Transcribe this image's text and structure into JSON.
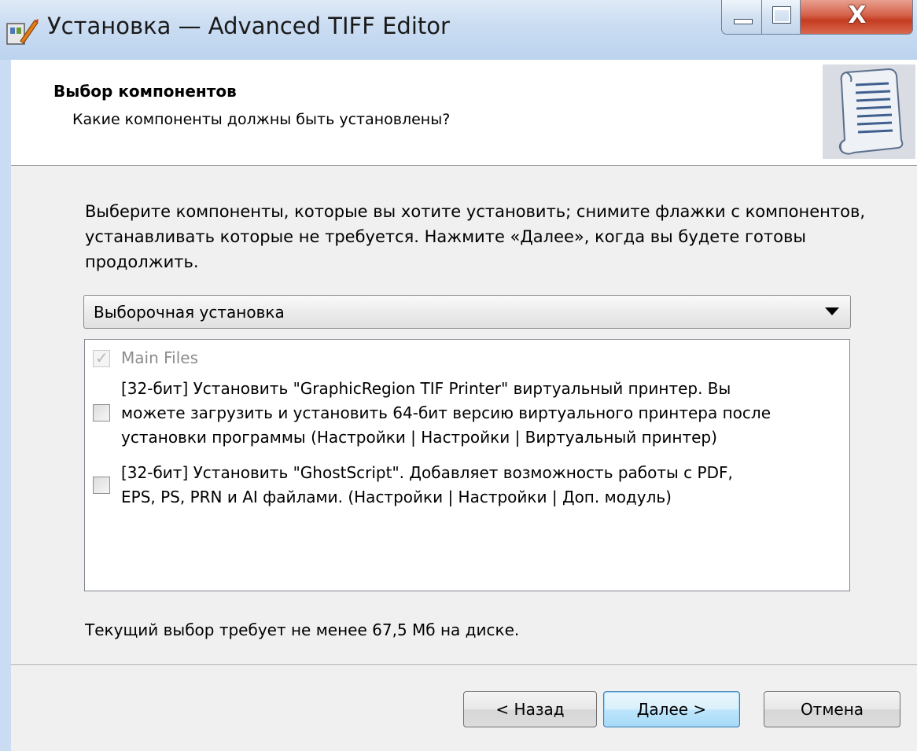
{
  "window": {
    "title": "Установка — Advanced TIFF Editor",
    "close_glyph": "X"
  },
  "header": {
    "title": "Выбор компонентов",
    "subtitle": "Какие компоненты должны быть установлены?"
  },
  "body": {
    "instruction": "Выберите компоненты, которые вы хотите установить; снимите флажки с компонентов, устанавливать которые не требуется. Нажмите «Далее», когда вы будете готовы продолжить.",
    "install_type": {
      "selected": "Выборочная установка"
    },
    "components": [
      {
        "lines": [
          "Main Files"
        ],
        "checked": true,
        "enabled": false
      },
      {
        "lines": [
          "[32-бит] Установить \"GraphicRegion TIF Printer\" виртуальный принтер. Вы",
          "можете загрузить и установить 64-бит версию виртуального принтера после",
          "установки программы (Настройки | Настройки | Виртуальный принтер)"
        ],
        "checked": false,
        "enabled": true
      },
      {
        "lines": [
          "[32-бит] Установить \"GhostScript\". Добавляет возможность работы с PDF,",
          "EPS, PS, PRN и AI файлами. (Настройки | Настройки | Доп. модуль)"
        ],
        "checked": false,
        "enabled": true
      }
    ],
    "check_mark": "✓",
    "disk_requirement": "Текущий выбор требует не менее 67,5 Мб на диске."
  },
  "buttons": {
    "back": "< Назад",
    "next": "Далее >",
    "cancel": "Отмена"
  },
  "colors": {
    "titlebar": "#c9dcf2",
    "close_button": "#c43c22",
    "default_button_border": "#3c7fb1"
  },
  "icons": {
    "app": "installer-app-icon",
    "wizard": "scroll-document-icon",
    "dropdown": "triangle-down-icon"
  }
}
